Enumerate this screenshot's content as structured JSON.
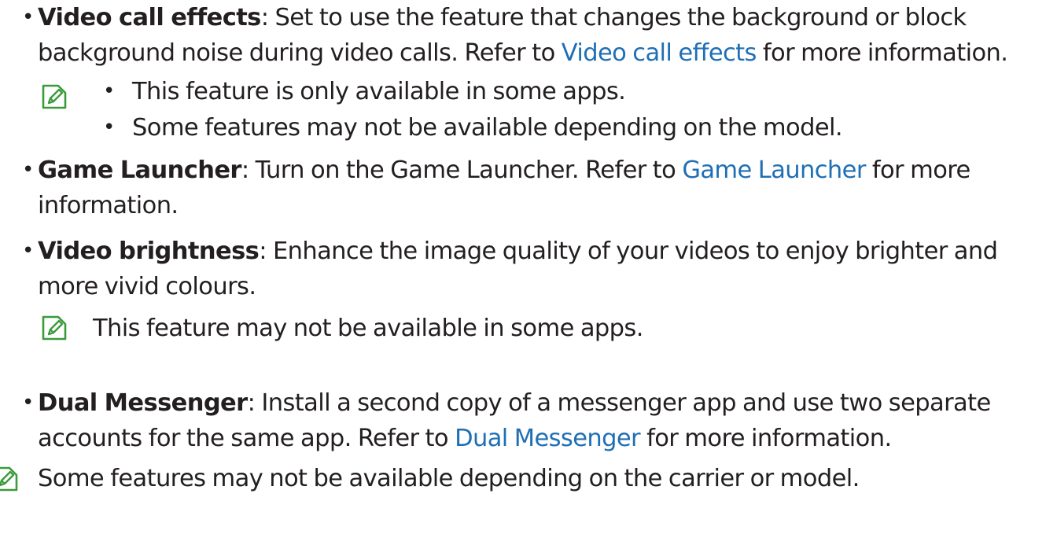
{
  "items": [
    {
      "term": "Video call effects",
      "text_before_link": ": Set to use the feature that changes the background or block background noise during video calls. Refer to ",
      "link": "Video call effects",
      "text_after_link": " for more information.",
      "notes": [
        "This feature is only available in some apps.",
        "Some features may not be available depending on the model."
      ]
    },
    {
      "term": "Game Launcher",
      "text_before_link": ": Turn on the Game Launcher. Refer to ",
      "link": "Game Launcher",
      "text_after_link": " for more information."
    },
    {
      "term": "Video brightness",
      "text": ": Enhance the image quality of your videos to enjoy brighter and more vivid colours.",
      "note": "This feature may not be available in some apps."
    },
    {
      "term": "Dual Messenger",
      "text_before_link": ": Install a second copy of a messenger app and use two separate accounts for the same app. Refer to ",
      "link": "Dual Messenger",
      "text_after_link": " for more information."
    }
  ],
  "final_note": "Some features may not be available depending on the carrier or model.",
  "colors": {
    "text": "#231f20",
    "link": "#1f6fb5",
    "note_icon": "#3a9b3a"
  },
  "icons": {
    "note": "note-pencil-icon",
    "bullet": "bullet-dot"
  }
}
